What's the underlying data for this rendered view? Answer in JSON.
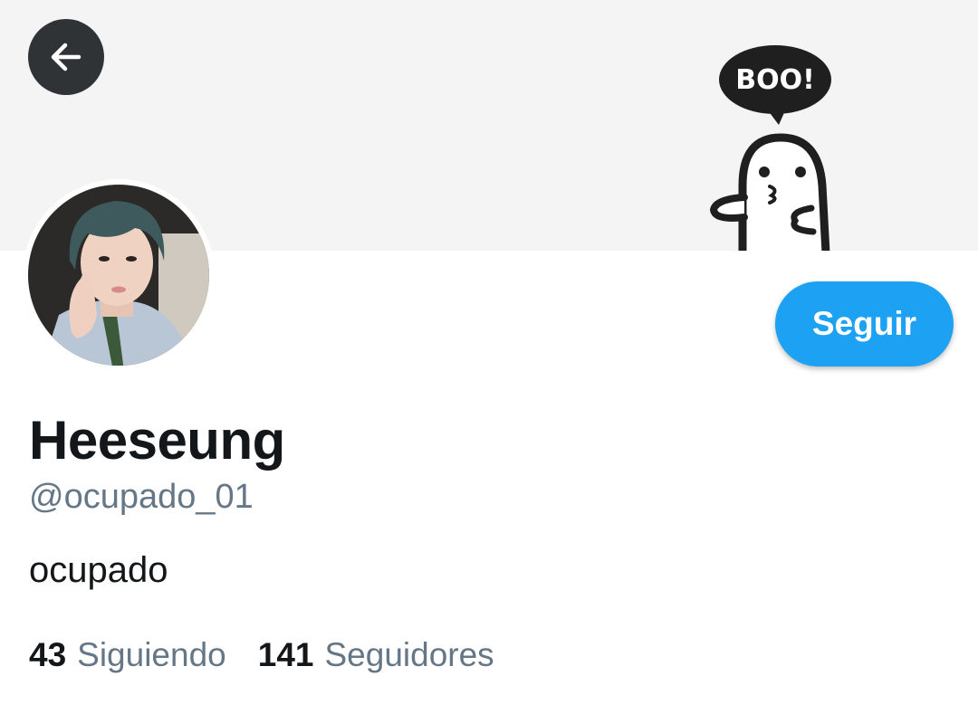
{
  "header": {
    "back_icon": "arrow-left-icon",
    "banner_text": "BOO!"
  },
  "profile": {
    "display_name": "Heeseung",
    "handle": "@ocupado_01",
    "bio": "ocupado",
    "follow_label": "Seguir"
  },
  "stats": {
    "following_count": "43",
    "following_label": "Siguiendo",
    "followers_count": "141",
    "followers_label": "Seguidores"
  },
  "colors": {
    "accent": "#1da1f2",
    "secondary_text": "#657786",
    "primary_text": "#14171a",
    "banner_bg": "#f4f4f4"
  }
}
